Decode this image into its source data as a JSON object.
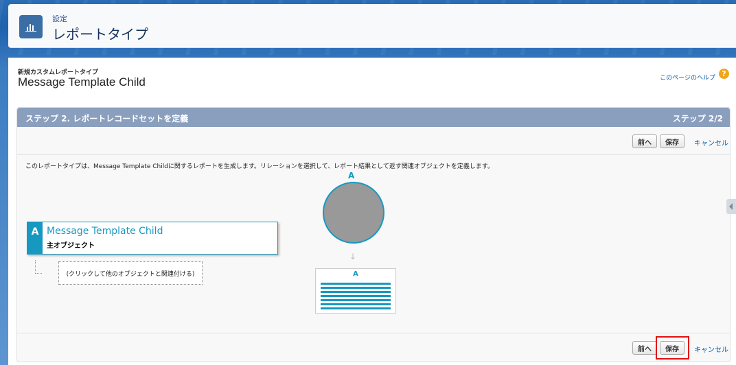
{
  "header": {
    "subtitle": "設定",
    "title": "レポートタイプ",
    "icon": "report-icon"
  },
  "page": {
    "small_label": "新規カスタムレポートタイプ",
    "title": "Message Template Child",
    "help_link": "このページのヘルプ",
    "help_icon": "?"
  },
  "step": {
    "title": "ステップ 2. レポートレコードセットを定義",
    "count": "ステップ 2/2",
    "prev_label": "前へ",
    "save_label": "保存",
    "cancel_label": "キャンセル"
  },
  "description": "このレポートタイプは、Message Template Childに関するレポートを生成します。リレーションを選択して、レポート結果として返す関連オブジェクトを定義します。",
  "primary_object": {
    "letter": "A",
    "name": "Message Template Child",
    "type_label": "主オブジェクト"
  },
  "relate_placeholder": "(クリックして他のオブジェクトと関連付ける)",
  "diagram": {
    "circle_letter": "A",
    "table_letter": "A",
    "arrow": "↓"
  },
  "colors": {
    "accent": "#1798c1",
    "step_header": "#8a9ebe",
    "highlight": "#e01010"
  }
}
